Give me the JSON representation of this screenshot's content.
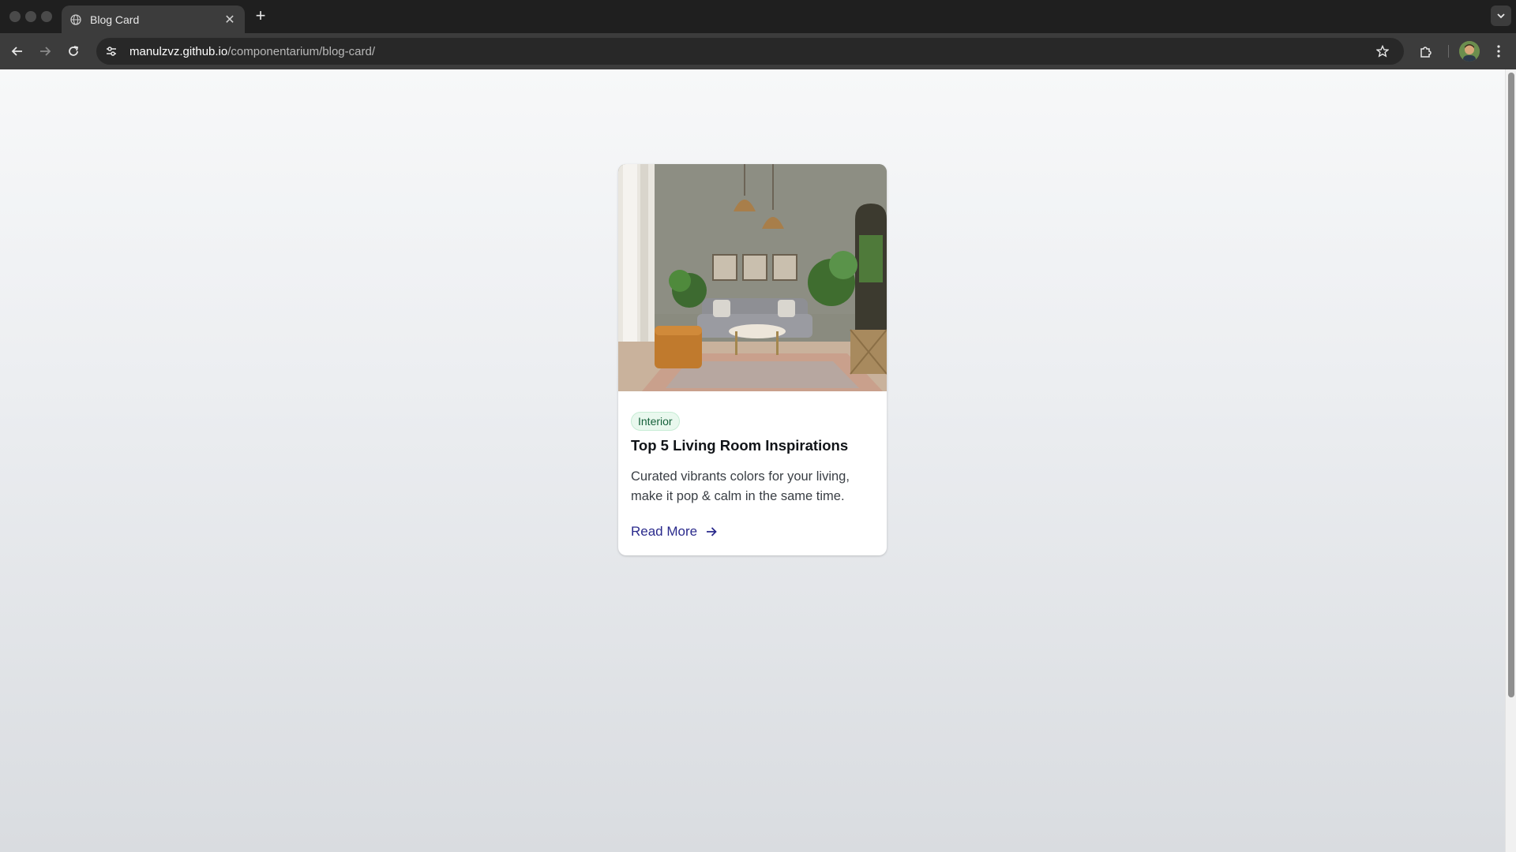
{
  "browser": {
    "tab": {
      "title": "Blog Card",
      "close_glyph": "✕"
    },
    "new_tab_glyph": "+",
    "address": {
      "host": "manulzvz.github.io",
      "path": "/componentarium/blog-card/"
    },
    "icons": {
      "favicon": "globe-icon",
      "back": "arrow-left-icon",
      "forward": "arrow-right-icon",
      "reload": "reload-icon",
      "site_info": "tune-icon",
      "bookmark": "star-icon",
      "extensions": "puzzle-icon",
      "profile": "avatar",
      "menu": "kebab-menu-icon",
      "tab_search": "chevron-down-icon"
    }
  },
  "card": {
    "image_alt": "Living room interior",
    "badge": "Interior",
    "title": "Top 5 Living Room Inspirations",
    "description": "Curated vibrants colors for your living, make it pop & calm in the same time.",
    "link_label": "Read More",
    "link_icon": "arrow-right-icon"
  },
  "colors": {
    "badge_bg": "#e9f8ee",
    "badge_text": "#15613a",
    "link": "#2a2a8c",
    "chrome_dark": "#1f1f1f",
    "toolbar": "#3c3c3c"
  }
}
